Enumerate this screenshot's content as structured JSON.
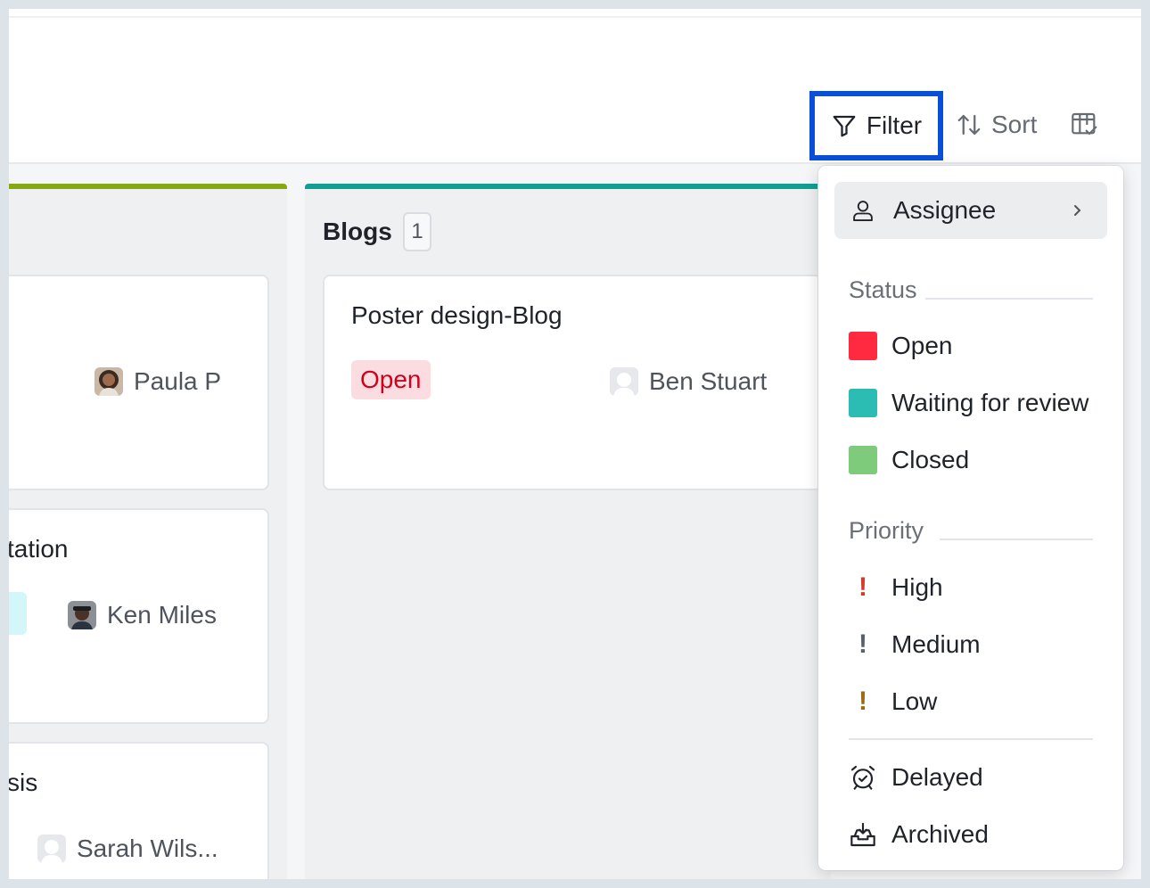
{
  "toolbar": {
    "filter_label": "Filter",
    "sort_label": "Sort",
    "columns_icon": "table-columns-icon"
  },
  "board": {
    "left_column": {
      "color": "#86a813",
      "cards": [
        {
          "assignee": "Paula P"
        },
        {
          "title_fragment": "tation",
          "assignee": "Ken Miles"
        },
        {
          "title_fragment": "sis",
          "assignee": "Sarah Wils..."
        }
      ]
    },
    "blogs_column": {
      "color": "#129e94",
      "title": "Blogs",
      "count": "1",
      "cards": [
        {
          "title": "Poster design-Blog",
          "status": "Open",
          "assignee": "Ben Stuart"
        }
      ]
    }
  },
  "filter_menu": {
    "assignee_label": "Assignee",
    "status_heading": "Status",
    "statuses": [
      {
        "label": "Open",
        "color": "#ff2a3f"
      },
      {
        "label": "Waiting for review",
        "color": "#2bbcb3"
      },
      {
        "label": "Closed",
        "color": "#7fcb7c"
      }
    ],
    "priority_heading": "Priority",
    "priorities": [
      {
        "label": "High",
        "color": "#d43a2f"
      },
      {
        "label": "Medium",
        "color": "#5b6068"
      },
      {
        "label": "Low",
        "color": "#9a6b12"
      }
    ],
    "delayed_label": "Delayed",
    "archived_label": "Archived"
  }
}
